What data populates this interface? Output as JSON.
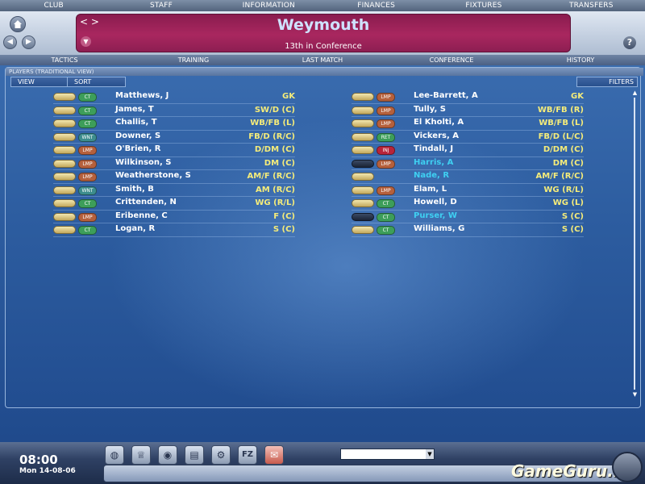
{
  "top_menu": [
    "CLUB",
    "STAFF",
    "INFORMATION",
    "FINANCES",
    "FIXTURES",
    "TRANSFERS"
  ],
  "header": {
    "arrows": "< >",
    "club_name": "Weymouth",
    "league_position": "13th in Conference",
    "help": "?"
  },
  "sub_menu": [
    "TACTICS",
    "TRAINING",
    "LAST MATCH",
    "CONFERENCE",
    "HISTORY"
  ],
  "panel": {
    "title": "PLAYERS (TRADITIONAL VIEW)",
    "view_label": "VIEW",
    "sort_label": "SORT",
    "filters_label": "FILTERS"
  },
  "players_left": [
    {
      "pill": "light",
      "badge": "CT",
      "name": "Matthews, J",
      "pos": "GK",
      "highlight": false
    },
    {
      "pill": "light",
      "badge": "CT",
      "name": "James, T",
      "pos": "SW/D (C)",
      "highlight": false
    },
    {
      "pill": "light",
      "badge": "CT",
      "name": "Challis, T",
      "pos": "WB/FB (L)",
      "highlight": false
    },
    {
      "pill": "light",
      "badge": "WNT",
      "name": "Downer, S",
      "pos": "FB/D (R/C)",
      "highlight": false
    },
    {
      "pill": "light",
      "badge": "LMP",
      "name": "O'Brien, R",
      "pos": "D/DM (C)",
      "highlight": false
    },
    {
      "pill": "light",
      "badge": "LMP",
      "name": "Wilkinson, S",
      "pos": "DM (C)",
      "highlight": false
    },
    {
      "pill": "light",
      "badge": "LMP",
      "name": "Weatherstone, S",
      "pos": "AM/F (R/C)",
      "highlight": false
    },
    {
      "pill": "light",
      "badge": "WNT",
      "name": "Smith, B",
      "pos": "AM (R/C)",
      "highlight": false
    },
    {
      "pill": "light",
      "badge": "CT",
      "name": "Crittenden, N",
      "pos": "WG (R/L)",
      "highlight": false
    },
    {
      "pill": "light",
      "badge": "LMP",
      "name": "Eribenne, C",
      "pos": "F (C)",
      "highlight": false
    },
    {
      "pill": "light",
      "badge": "CT",
      "name": "Logan, R",
      "pos": "S (C)",
      "highlight": false
    }
  ],
  "players_right": [
    {
      "pill": "light",
      "badge": "LMP",
      "name": "Lee-Barrett, A",
      "pos": "GK",
      "highlight": false
    },
    {
      "pill": "light",
      "badge": "LMP",
      "name": "Tully, S",
      "pos": "WB/FB (R)",
      "highlight": false
    },
    {
      "pill": "light",
      "badge": "LMP",
      "name": "El Kholti, A",
      "pos": "WB/FB (L)",
      "highlight": false
    },
    {
      "pill": "light",
      "badge": "RET",
      "name": "Vickers, A",
      "pos": "FB/D (L/C)",
      "highlight": false
    },
    {
      "pill": "light",
      "badge": "INJ",
      "name": "Tindall, J",
      "pos": "D/DM (C)",
      "highlight": false
    },
    {
      "pill": "dark",
      "badge": "LMP",
      "name": "Harris, A",
      "pos": "DM (C)",
      "highlight": true
    },
    {
      "pill": "light",
      "badge": "",
      "name": "Nade, R",
      "pos": "AM/F (R/C)",
      "highlight": true
    },
    {
      "pill": "light",
      "badge": "LMP",
      "name": "Elam, L",
      "pos": "WG (R/L)",
      "highlight": false
    },
    {
      "pill": "light",
      "badge": "CT",
      "name": "Howell, D",
      "pos": "WG (L)",
      "highlight": false
    },
    {
      "pill": "dark",
      "badge": "CT",
      "name": "Purser, W",
      "pos": "S (C)",
      "highlight": true
    },
    {
      "pill": "light",
      "badge": "CT",
      "name": "Williams, G",
      "pos": "S (C)",
      "highlight": false
    }
  ],
  "footer": {
    "time": "08:00",
    "date": "Mon 14-08-06",
    "watermark": "GameGuru.ru",
    "select_value": ""
  },
  "toolbar_icons": [
    "player-icon",
    "trophy-icon",
    "globe-icon",
    "notes-icon",
    "settings-icon",
    "fz-icon",
    "mail-icon"
  ]
}
